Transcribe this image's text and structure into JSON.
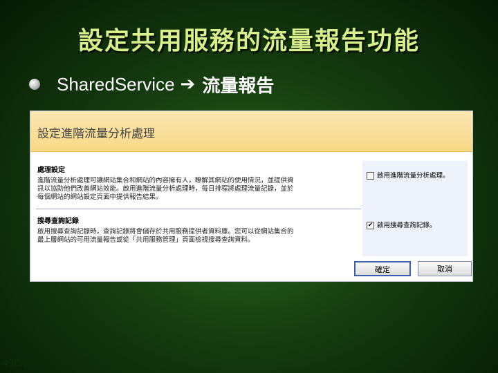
{
  "slide": {
    "title": "設定共用服務的流量報告功能",
    "bullet": {
      "text": "SharedService",
      "arrow": "➔",
      "suffix": "流量報告"
    },
    "page_number": "49/56"
  },
  "dialog": {
    "header_title": "設定進階流量分析處理",
    "section1": {
      "title": "處理設定",
      "lines": [
        "進階流量分析處理可讓網站集合和網站的內容擁有人，瞭解其網站的使用情況，並提供資",
        "訊以協助他們改善網站效能。啟用進階流量分析處理時，每日排程將處理流量記錄，並於",
        "每個網站的網站設定頁面中提供報告結果。"
      ]
    },
    "section2": {
      "title": "搜尋查詢記錄",
      "lines": [
        "啟用搜尋查詢記錄時，查詢記錄將會儲存於共用服務提供者資料庫。您可以從網站集合的",
        "最上層網站的可用流量報告或從「共用服務管理」頁面檢視搜尋查詢資料。"
      ]
    },
    "option1": {
      "label": "啟用進階流量分析處理。",
      "checked": false,
      "mark": ""
    },
    "option2": {
      "label": "啟用搜尋查詢記錄。",
      "checked": true,
      "mark": "✔"
    },
    "ok_label": "確定",
    "cancel_label": "取消"
  }
}
